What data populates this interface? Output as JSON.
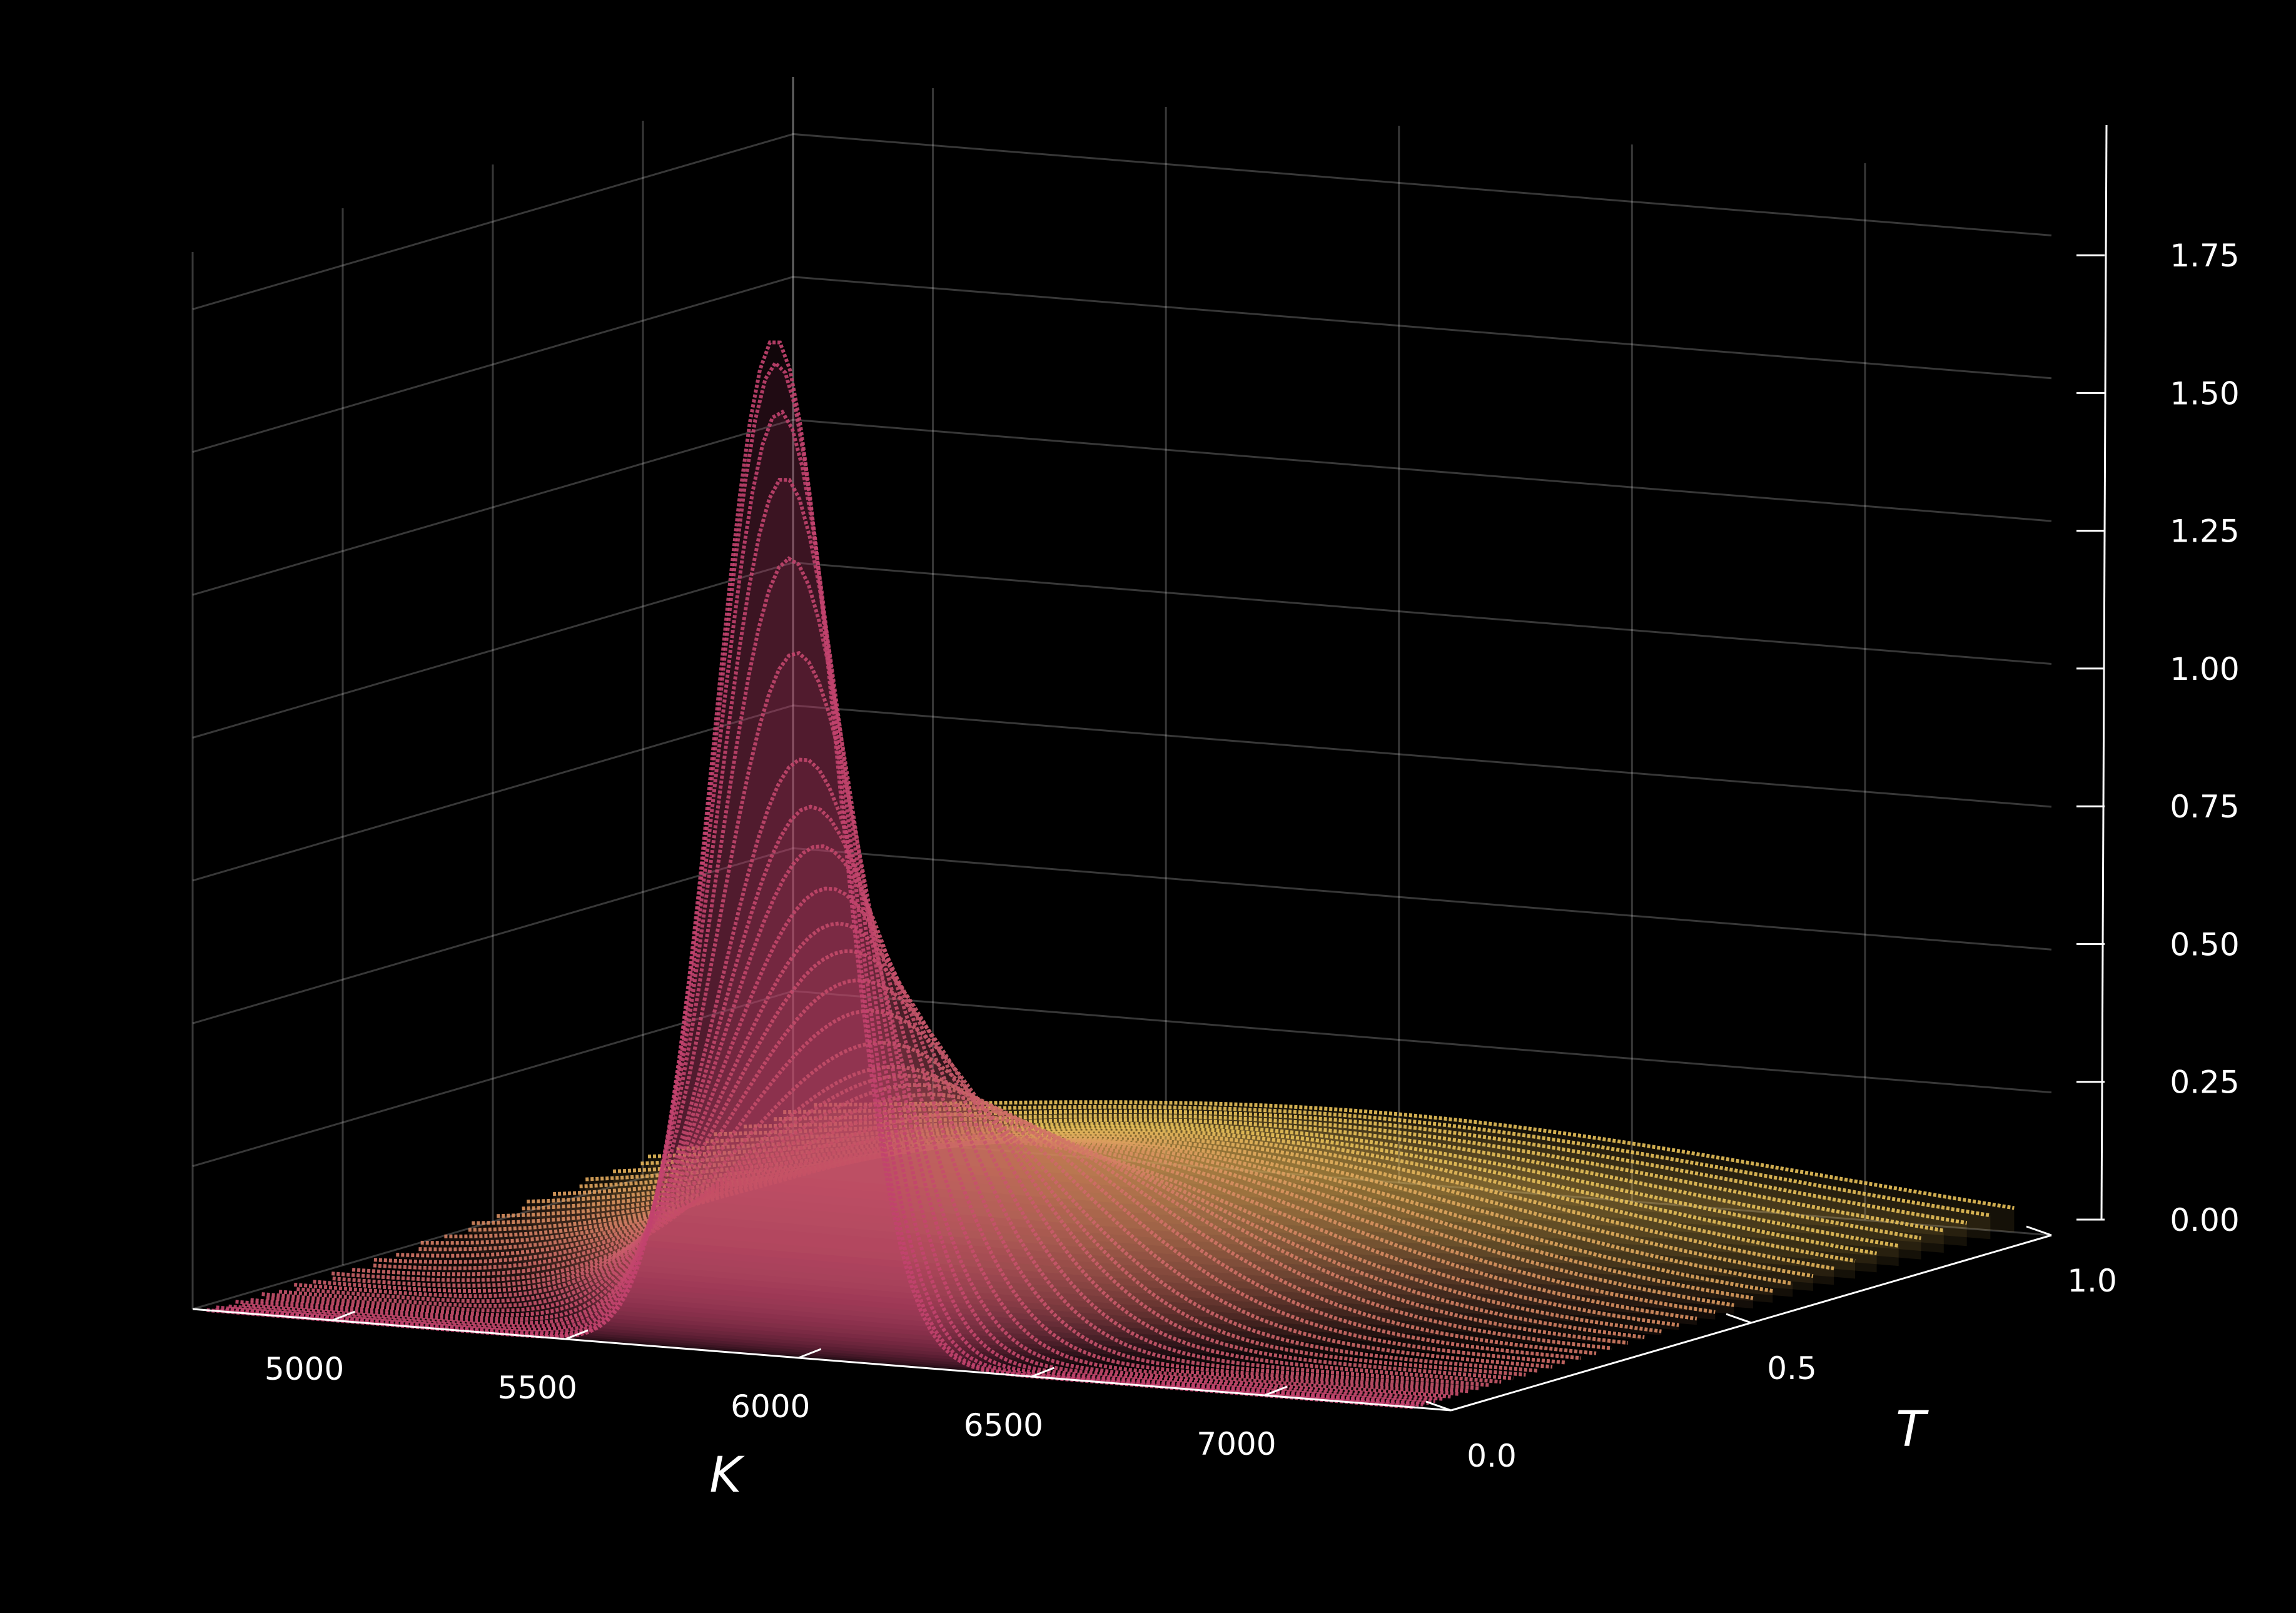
{
  "chart_data": {
    "type": "surface",
    "title": "",
    "xlabel": "K",
    "ylabel": "T",
    "zlabel": "",
    "x_ticks": [
      5000,
      5500,
      6000,
      6500,
      7000
    ],
    "y_ticks": [
      "0.0",
      "0.5",
      "1.0"
    ],
    "z_ticks": [
      "0.00",
      "0.25",
      "0.50",
      "0.75",
      "1.00",
      "1.25",
      "1.50",
      "1.75"
    ],
    "xlim": [
      4700,
      7400
    ],
    "ylim": [
      0.0,
      1.0
    ],
    "zlim": [
      0.0,
      1.85
    ],
    "grid": true,
    "background": "#000000",
    "colormap": {
      "low_T": "#c2426e",
      "high_T": "#e8c15a"
    },
    "surface": {
      "description_points": [
        {
          "T": 0.0,
          "peak_K": 5950,
          "peak_value": 1.78,
          "width_K": 130
        },
        {
          "T": 0.05,
          "peak_K": 5950,
          "peak_value": 1.0,
          "width_K": 180
        },
        {
          "T": 0.1,
          "peak_K": 5950,
          "peak_value": 0.75,
          "width_K": 230
        },
        {
          "T": 0.2,
          "peak_K": 5950,
          "peak_value": 0.45,
          "width_K": 320
        },
        {
          "T": 0.4,
          "peak_K": 5950,
          "peak_value": 0.25,
          "width_K": 500
        },
        {
          "T": 0.6,
          "peak_K": 5950,
          "peak_value": 0.19,
          "width_K": 650
        },
        {
          "T": 0.8,
          "peak_K": 5950,
          "peak_value": 0.15,
          "width_K": 800
        },
        {
          "T": 1.0,
          "peak_K": 5950,
          "peak_value": 0.12,
          "width_K": 950
        }
      ]
    }
  }
}
